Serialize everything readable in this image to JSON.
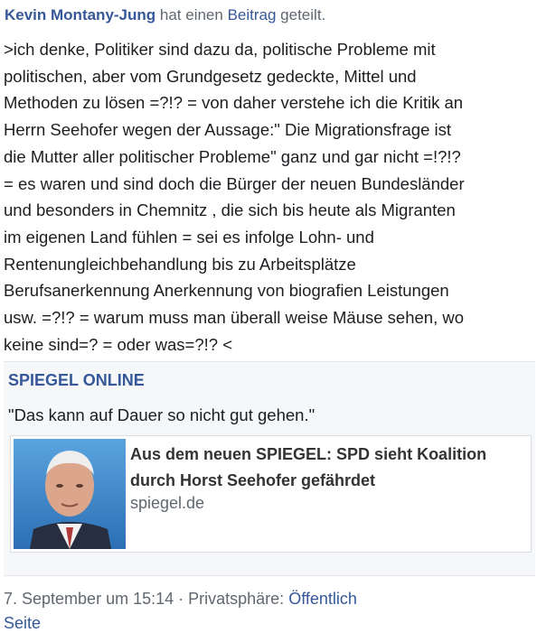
{
  "post": {
    "author": "Kevin Montany-Jung",
    "action_before": " hat einen ",
    "action_link": "Beitrag",
    "action_after": " geteilt.",
    "lines": [
      ">ich denke, Politiker sind dazu da, politische Probleme mit",
      "politischen, aber vom Grundgesetz gedeckte, Mittel und",
      "Methoden zu lösen =?!? = von daher verstehe ich die Kritik an",
      "Herrn Seehofer wegen der Aussage:\" Die Migrationsfrage ist",
      "die Mutter aller politischer Probleme\" ganz und gar nicht =!?!?",
      "= es waren und sind doch die Bürger der neuen Bundesländer",
      "und besonders in Chemnitz , die sich bis heute als Migranten",
      "im eigenen Land fühlen = sei es infolge Lohn- und",
      "Rentenungleichbehandlung bis zu Arbeitsplätze",
      "Berufsanerkennung Anerkennung von biografien Leistungen",
      "usw. =?!? = warum muss man überall weise Mäuse sehen, wo",
      "keine sind=? = oder was=?!? <"
    ]
  },
  "shared": {
    "source": "SPIEGEL ONLINE",
    "quote": "\"Das kann auf Dauer so nicht gut gehen.\"",
    "card": {
      "title": "Aus dem neuen SPIEGEL: SPD sieht Koalition durch Horst Seehofer gefährdet",
      "domain": "spiegel.de"
    }
  },
  "footer": {
    "date": "7. September um 15:14",
    "separator": " · ",
    "privacy_label": "Privatsphäre: ",
    "privacy_value": "Öffentlich",
    "cut_link": "Seite"
  },
  "colors": {
    "link": "#365899",
    "meta": "#606770",
    "text": "#1c1e21",
    "share_bg": "#f6f7f9"
  }
}
